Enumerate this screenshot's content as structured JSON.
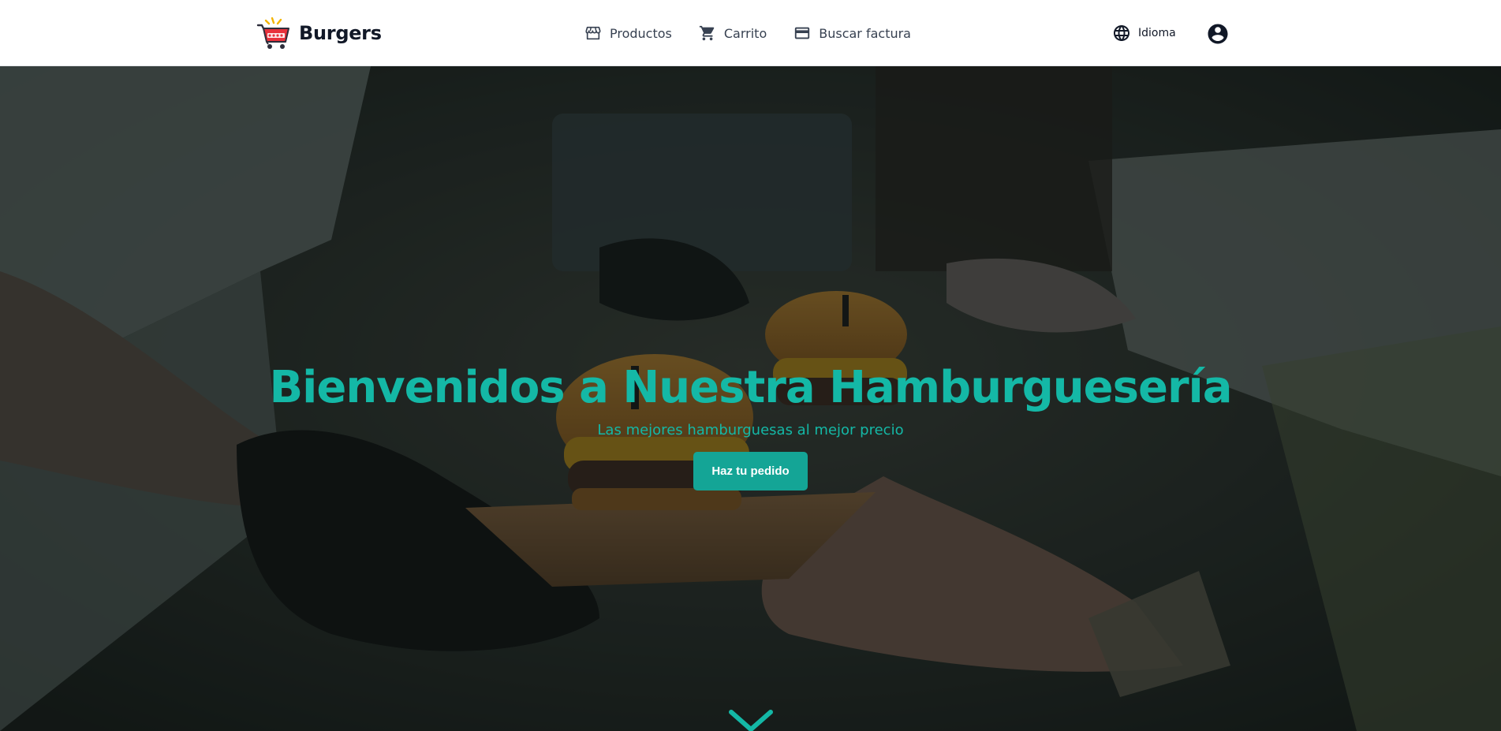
{
  "brand": {
    "name": "Burgers",
    "logo_icon": "shopping-cart-logo-icon"
  },
  "nav": {
    "items": [
      {
        "label": "Productos",
        "icon": "storefront-icon"
      },
      {
        "label": "Carrito",
        "icon": "shopping-cart-icon"
      },
      {
        "label": "Buscar factura",
        "icon": "credit-card-icon"
      }
    ]
  },
  "language": {
    "label": "Idioma",
    "icon": "globe-icon"
  },
  "account": {
    "icon": "account-circle-icon"
  },
  "hero": {
    "title": "Bienvenidos a Nuestra Hamburguesería",
    "subtitle": "Las mejores hamburguesas al mejor precio",
    "cta_label": "Haz tu pedido",
    "scroll_icon": "chevron-down-icon"
  },
  "colors": {
    "accent": "#14b8a6",
    "button": "#14a596",
    "header_bg": "#ffffff",
    "text_dark": "#111827"
  }
}
